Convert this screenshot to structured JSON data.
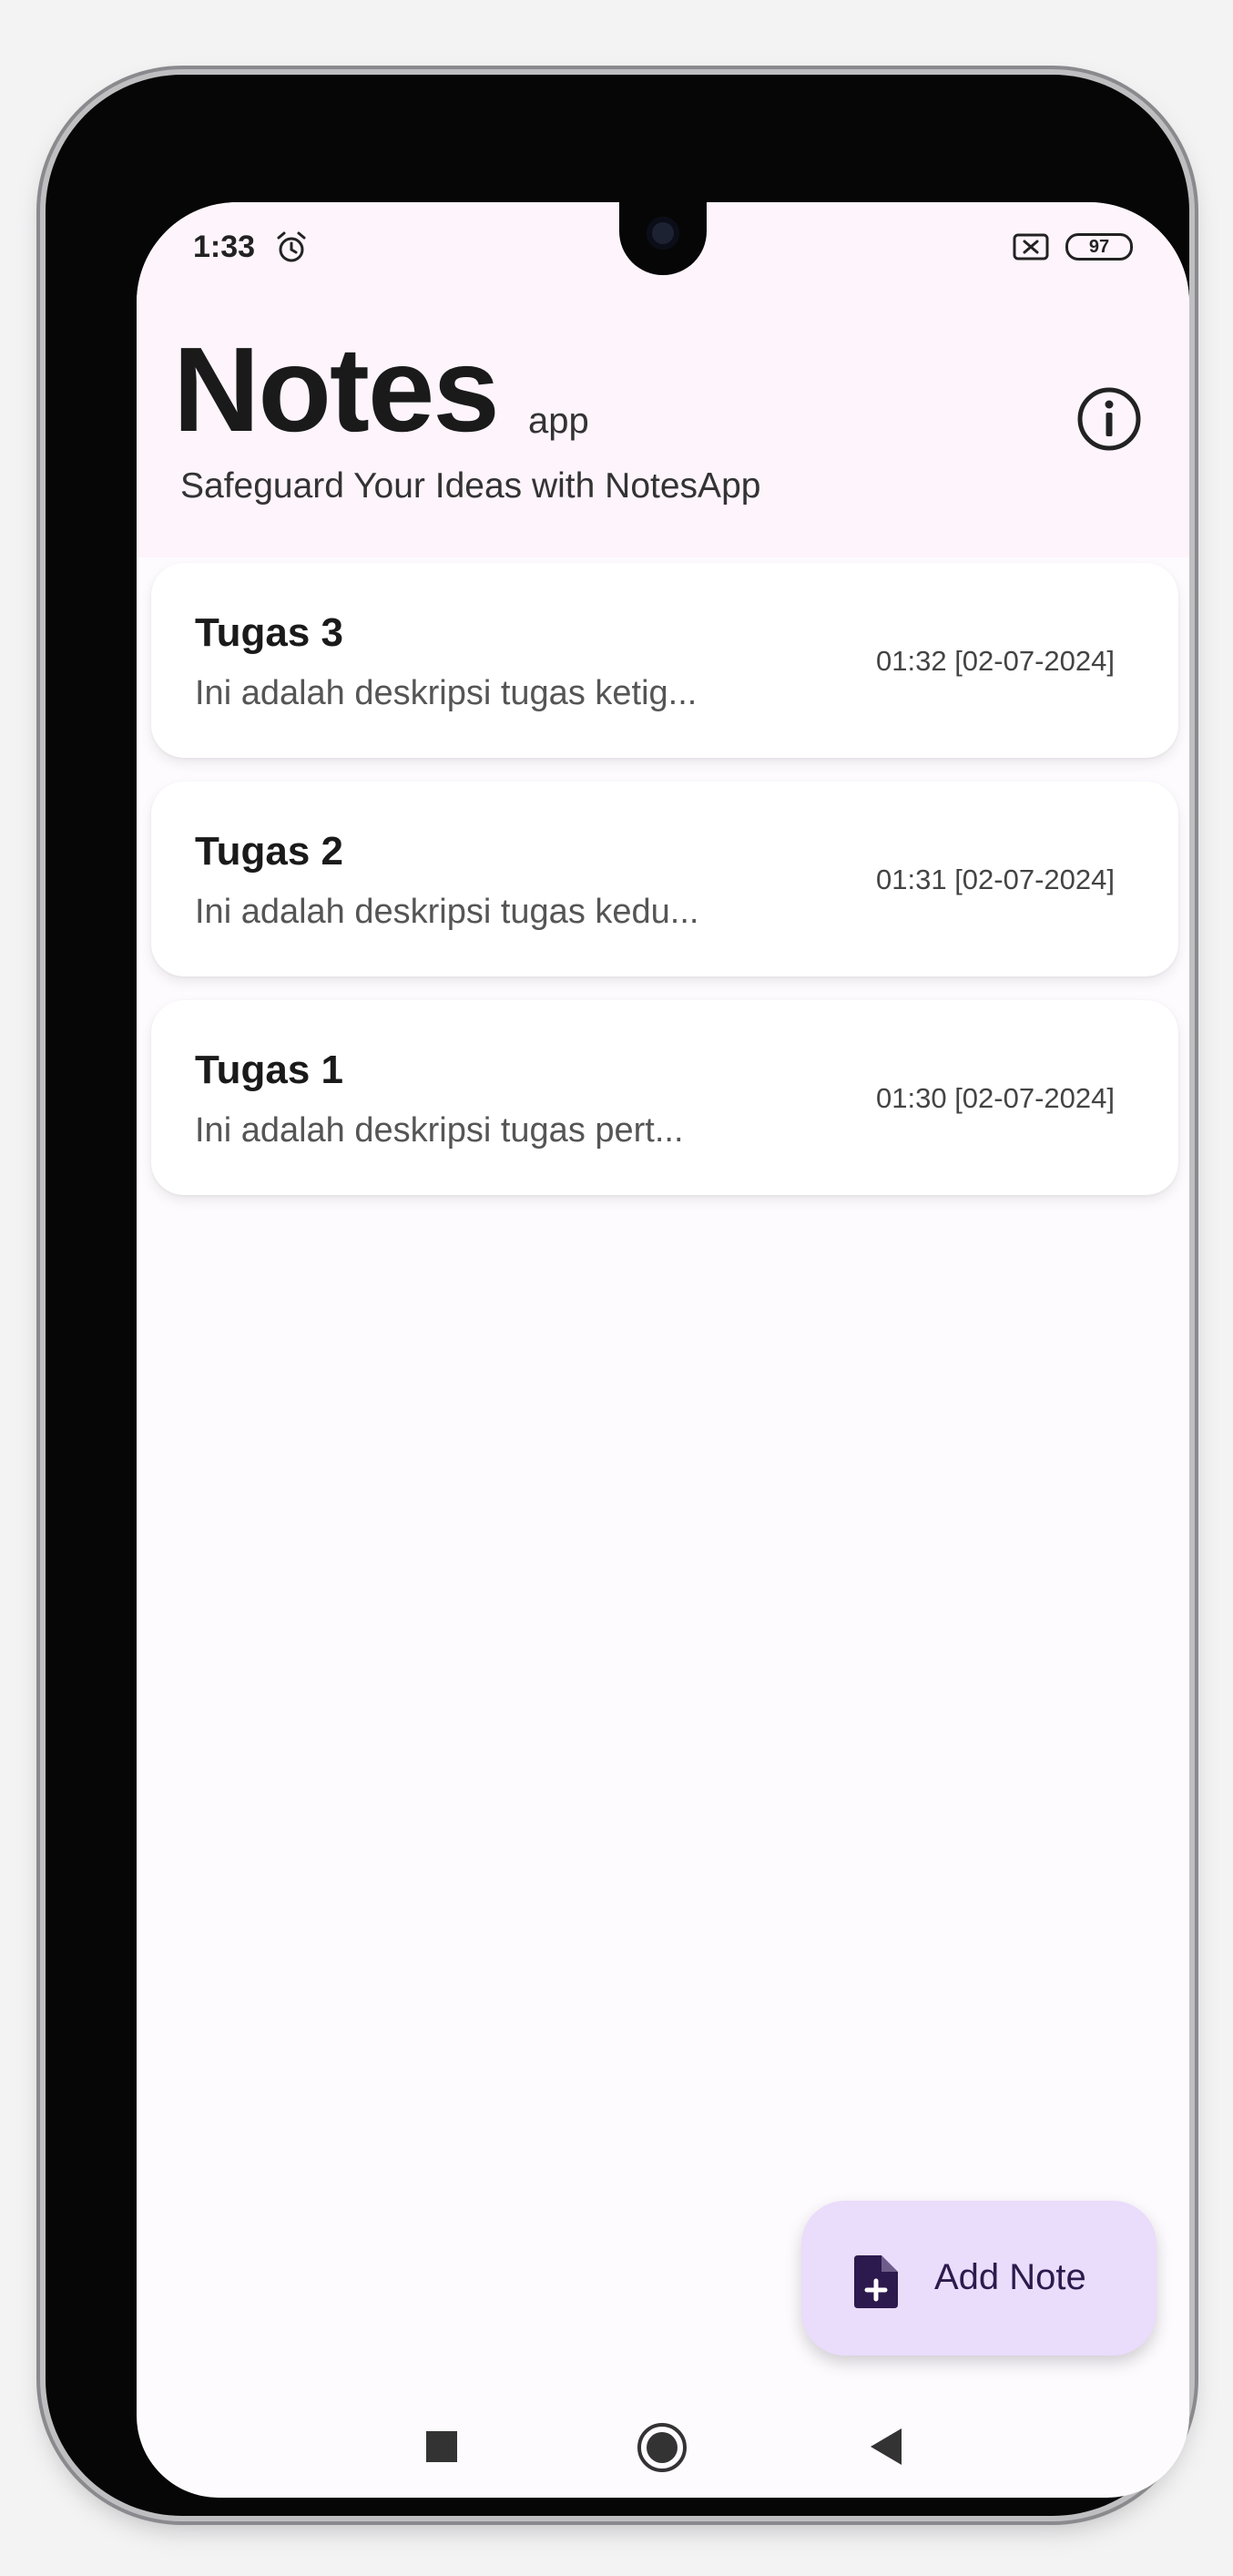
{
  "status_bar": {
    "time": "1:33",
    "battery": "97"
  },
  "header": {
    "title": "Notes",
    "title_suffix": "app",
    "subtitle": "Safeguard Your Ideas with NotesApp"
  },
  "notes": [
    {
      "title": "Tugas 3",
      "description": "Ini adalah deskripsi tugas ketig...",
      "timestamp": "01:32 [02-07-2024]"
    },
    {
      "title": "Tugas 2",
      "description": "Ini adalah deskripsi tugas kedu...",
      "timestamp": "01:31 [02-07-2024]"
    },
    {
      "title": "Tugas 1",
      "description": "Ini adalah deskripsi tugas pert...",
      "timestamp": "01:30 [02-07-2024]"
    }
  ],
  "fab": {
    "label": "Add Note",
    "icon": "note-add-icon"
  },
  "colors": {
    "fab_background": "#eadcfb",
    "fab_icon": "#2c1a4e",
    "header_background": "#fdf4fc",
    "screen_background": "#fefbff"
  }
}
